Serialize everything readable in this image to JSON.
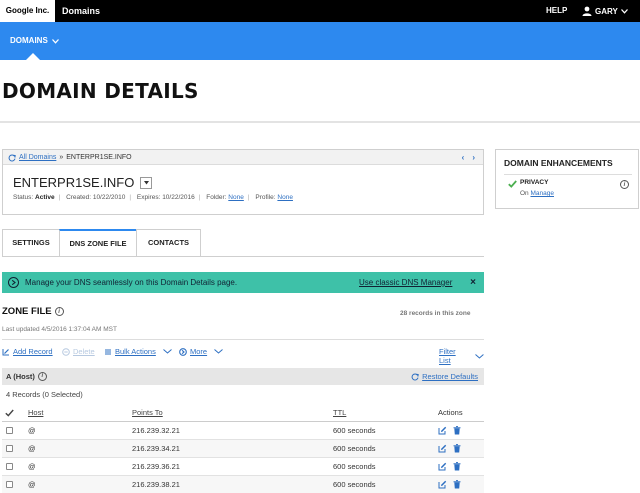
{
  "topbar": {
    "brand": "Google Inc.",
    "product": "Domains",
    "help": "HELP",
    "user": "GARY"
  },
  "nav": {
    "domains": "DOMAINS"
  },
  "page": {
    "title": "DOMAIN DETAILS"
  },
  "breadcrumb": {
    "all_domains": "All Domains",
    "separator": "»",
    "current": "ENTERPR1SE.INFO"
  },
  "domain": {
    "name": "ENTERPR1SE.INFO",
    "status_label": "Status:",
    "status": "Active",
    "created_label": "Created:",
    "created": "10/22/2010",
    "expires_label": "Expires:",
    "expires": "10/22/2016",
    "folder_label": "Folder:",
    "folder": "None",
    "profile_label": "Profile:",
    "profile": "None"
  },
  "enhancements": {
    "title": "DOMAIN ENHANCEMENTS",
    "privacy": "PRIVACY",
    "privacy_state": "On",
    "manage": "Manage"
  },
  "tabs": [
    {
      "label": "SETTINGS"
    },
    {
      "label": "DNS ZONE FILE"
    },
    {
      "label": "CONTACTS"
    }
  ],
  "banner": {
    "message": "Manage your DNS seamlessly on this Domain Details page.",
    "link": "Use classic DNS Manager",
    "close": "×"
  },
  "zone": {
    "title": "ZONE FILE",
    "count": "28 records in this zone",
    "updated": "Last updated 4/5/2016 1:37:04 AM MST"
  },
  "toolbar": {
    "add": "Add Record",
    "delete": "Delete",
    "bulk": "Bulk Actions",
    "more": "More",
    "filter": "Filter List"
  },
  "section": {
    "label": "A (Host)",
    "restore": "Restore Defaults",
    "records": "4 Records (0 Selected)"
  },
  "table": {
    "headers": {
      "host": "Host",
      "points_to": "Points To",
      "ttl": "TTL",
      "actions": "Actions"
    },
    "rows": [
      {
        "host": "@",
        "points_to": "216.239.32.21",
        "ttl": "600 seconds"
      },
      {
        "host": "@",
        "points_to": "216.239.34.21",
        "ttl": "600 seconds"
      },
      {
        "host": "@",
        "points_to": "216.239.36.21",
        "ttl": "600 seconds"
      },
      {
        "host": "@",
        "points_to": "216.239.38.21",
        "ttl": "600 seconds"
      }
    ]
  },
  "colors": {
    "brand_blue": "#2d89ef",
    "banner_teal": "#3ec1a8",
    "link": "#2d6fc2"
  }
}
